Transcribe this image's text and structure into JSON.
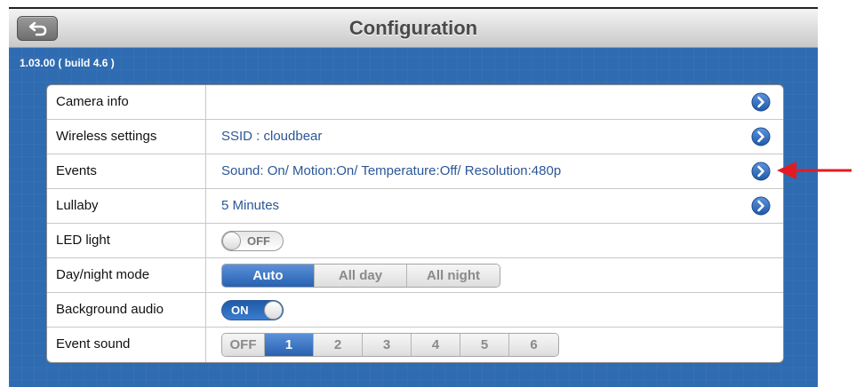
{
  "header": {
    "title": "Configuration"
  },
  "version": "1.03.00 ( build 4.6 )",
  "settings": {
    "camera_info": {
      "label": "Camera info",
      "value": ""
    },
    "wireless": {
      "label": "Wireless settings",
      "value": "SSID : cloudbear"
    },
    "events": {
      "label": "Events",
      "value": "Sound: On/ Motion:On/ Temperature:Off/ Resolution:480p"
    },
    "lullaby": {
      "label": "Lullaby",
      "value": "5 Minutes"
    },
    "led": {
      "label": "LED light",
      "state": "OFF"
    },
    "daynight": {
      "label": "Day/night mode",
      "options": [
        "Auto",
        "All day",
        "All night"
      ],
      "selected": "Auto"
    },
    "bg_audio": {
      "label": "Background audio",
      "state": "ON"
    },
    "event_sound": {
      "label": "Event sound",
      "options": [
        "OFF",
        "1",
        "2",
        "3",
        "4",
        "5",
        "6"
      ],
      "selected": "1"
    }
  },
  "icons": {
    "back": "back-arrow-icon",
    "disclosure": "chevron-right-circle-icon",
    "annotation": "red-arrow-icon"
  },
  "colors": {
    "background": "#2f6bb0",
    "accent": "#2761b1",
    "value_text": "#2c5697",
    "annotation": "#e21b23"
  }
}
